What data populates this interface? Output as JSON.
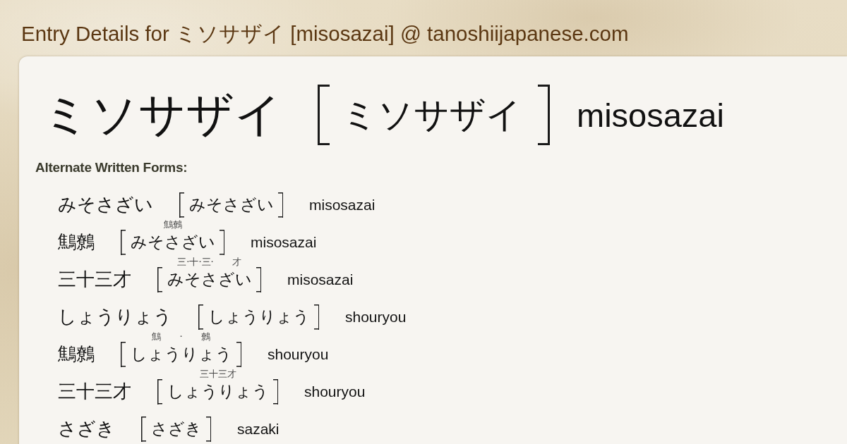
{
  "page_title": "Entry Details for ミソサザイ [misosazai] @ tanoshiijapanese.com",
  "entry": {
    "written": "ミソサザイ",
    "reading": "ミソサザイ",
    "romaji": "misosazai"
  },
  "alternate_written_forms": {
    "heading": "Alternate Written Forms:",
    "items": [
      {
        "written": "みそさざい",
        "reading": "みそさざい",
        "romaji": "misosazai"
      },
      {
        "written": "鷦鷯",
        "reading": "みそさざい",
        "reading_annotation": "鷦鷯",
        "romaji": "misosazai"
      },
      {
        "written": "三十三才",
        "reading": "みそさざい",
        "reading_annotation": "三·十·三·　　才",
        "romaji": "misosazai"
      },
      {
        "written": "しょうりょう",
        "reading": "しょうりょう",
        "romaji": "shouryou"
      },
      {
        "written": "鷦鷯",
        "reading": "しょうりょう",
        "reading_annotation": "鷦　　·　　鷯",
        "romaji": "shouryou"
      },
      {
        "written": "三十三才",
        "reading": "しょうりょう",
        "reading_annotation": "三十三才",
        "romaji": "shouryou"
      },
      {
        "written": "さざき",
        "reading": "さざき",
        "romaji": "sazaki"
      }
    ]
  }
}
